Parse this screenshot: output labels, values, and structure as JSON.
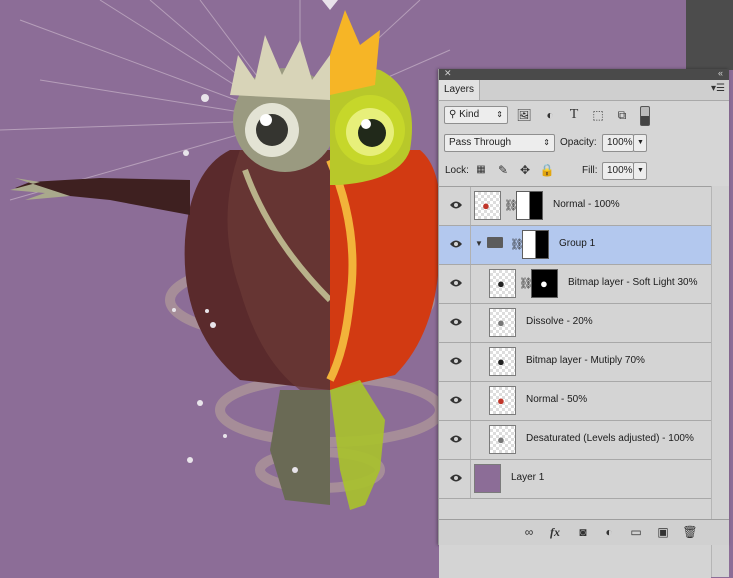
{
  "panel": {
    "tab_label": "Layers",
    "collapse_icon": "double-chevron-left-icon",
    "close_icon": "close-icon",
    "menu_icon": "panel-menu-icon"
  },
  "filter": {
    "kind_label": "Kind",
    "filter_icons": [
      "image-filter-icon",
      "adjustment-filter-icon",
      "type-filter-icon",
      "shape-filter-icon",
      "smart-object-filter-icon",
      "filter-toggle-icon"
    ]
  },
  "blend": {
    "mode": "Pass Through",
    "opacity_label": "Opacity:",
    "opacity_value": "100%"
  },
  "lock": {
    "lock_label": "Lock:",
    "fill_label": "Fill:",
    "fill_value": "100%"
  },
  "layers": [
    {
      "name": "Normal - 100%",
      "has_mask": true,
      "selected": false,
      "group": false,
      "indent": false,
      "thumb": "frog"
    },
    {
      "name": "Group 1",
      "has_mask": true,
      "selected": true,
      "group": true,
      "indent": false,
      "thumb": "folder"
    },
    {
      "name": "Bitmap layer - Soft Light 30%",
      "has_mask": true,
      "selected": false,
      "group": false,
      "indent": true,
      "thumb": "frog-bw"
    },
    {
      "name": "Dissolve - 20%",
      "has_mask": false,
      "selected": false,
      "group": false,
      "indent": true,
      "thumb": "frog-gray"
    },
    {
      "name": "Bitmap layer - Mutiply 70%",
      "has_mask": false,
      "selected": false,
      "group": false,
      "indent": true,
      "thumb": "frog-bw"
    },
    {
      "name": "Normal - 50%",
      "has_mask": false,
      "selected": false,
      "group": false,
      "indent": true,
      "thumb": "frog"
    },
    {
      "name": "Desaturated (Levels adjusted) - 100%",
      "has_mask": false,
      "selected": false,
      "group": false,
      "indent": true,
      "thumb": "frog-gray"
    },
    {
      "name": "Layer 1",
      "has_mask": false,
      "selected": false,
      "group": false,
      "indent": false,
      "thumb": "purple"
    }
  ],
  "bottom_icons": [
    "link-layers-icon",
    "fx-icon",
    "add-mask-icon",
    "new-adjustment-icon",
    "new-group-icon",
    "new-layer-icon",
    "trash-icon"
  ],
  "colors": {
    "canvas_bg": "#8c6d97",
    "layer_fill_purple": "#8c6d97",
    "selection": "#b3c8ee"
  }
}
